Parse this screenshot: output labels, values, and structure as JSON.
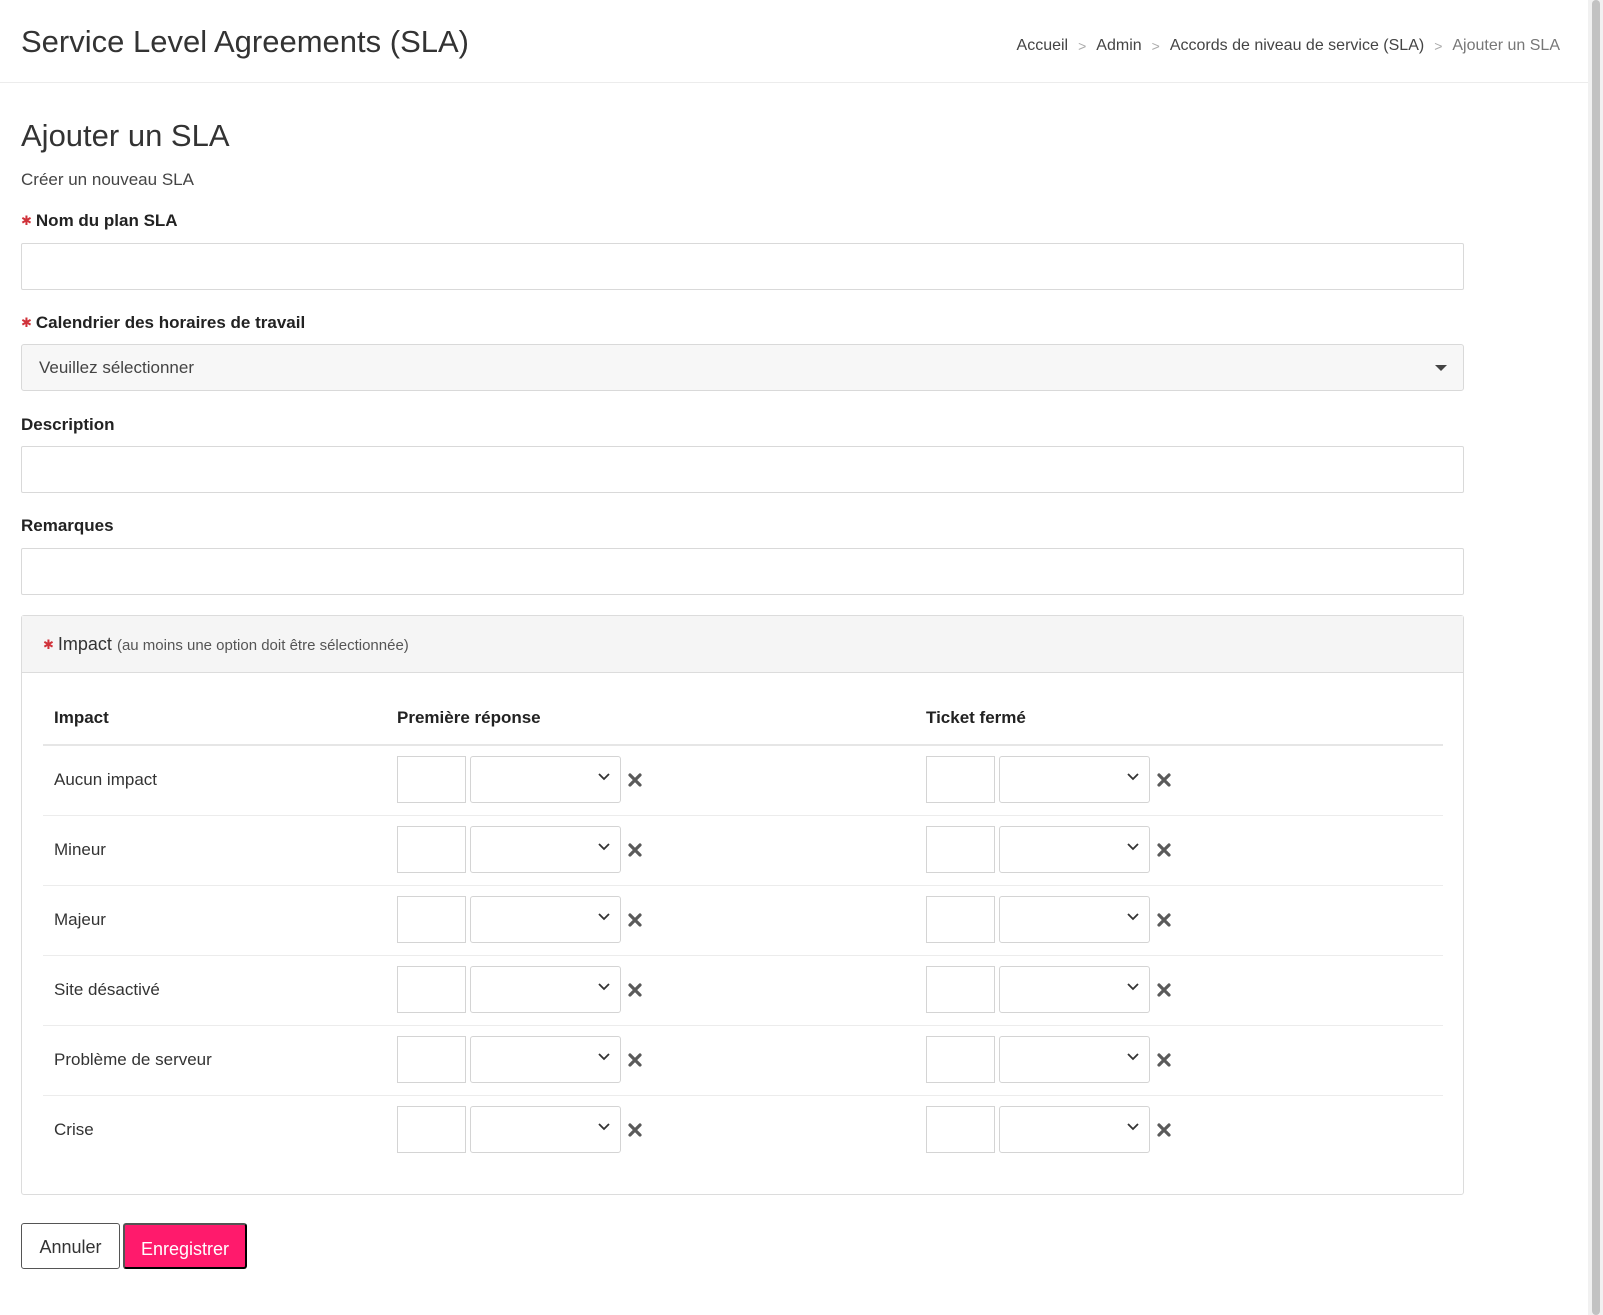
{
  "header": {
    "app_title": "Service Level Agreements (SLA)",
    "breadcrumb": [
      "Accueil",
      "Admin",
      "Accords de niveau de service (SLA)",
      "Ajouter un SLA"
    ],
    "breadcrumb_separator": ">"
  },
  "page": {
    "title": "Ajouter un SLA",
    "subtitle": "Créer un nouveau SLA"
  },
  "form": {
    "required_marker": "✱",
    "plan_name_label": "Nom du plan SLA",
    "plan_name_value": "",
    "calendar_label": "Calendrier des horaires de travail",
    "calendar_selected": "Veuillez sélectionner",
    "description_label": "Description",
    "description_value": "",
    "remarks_label": "Remarques",
    "remarks_value": ""
  },
  "impact_panel": {
    "title": "Impact",
    "hint": "(au moins une option doit être sélectionnée)",
    "columns": [
      "Impact",
      "Première réponse",
      "Ticket fermé"
    ],
    "rows": [
      {
        "label": "Aucun impact",
        "first_response_value": "",
        "first_response_unit": "",
        "closed_value": "",
        "closed_unit": ""
      },
      {
        "label": "Mineur",
        "first_response_value": "",
        "first_response_unit": "",
        "closed_value": "",
        "closed_unit": ""
      },
      {
        "label": "Majeur",
        "first_response_value": "",
        "first_response_unit": "",
        "closed_value": "",
        "closed_unit": ""
      },
      {
        "label": "Site désactivé",
        "first_response_value": "",
        "first_response_unit": "",
        "closed_value": "",
        "closed_unit": ""
      },
      {
        "label": "Problème de serveur",
        "first_response_value": "",
        "first_response_unit": "",
        "closed_value": "",
        "closed_unit": ""
      },
      {
        "label": "Crise",
        "first_response_value": "",
        "first_response_unit": "",
        "closed_value": "",
        "closed_unit": ""
      }
    ]
  },
  "actions": {
    "cancel_label": "Annuler",
    "save_label": "Enregistrer"
  },
  "colors": {
    "accent": "#ff1a6c",
    "required": "#d0323a"
  }
}
